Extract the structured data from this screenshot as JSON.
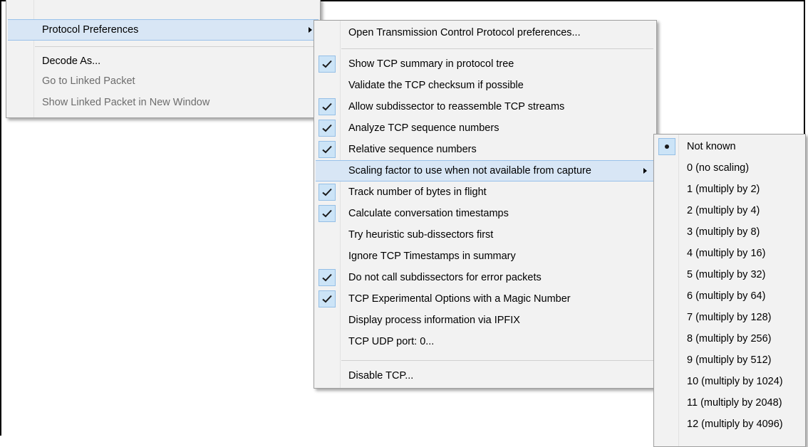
{
  "context_menu": {
    "items": [
      {
        "label": "Protocol Preferences",
        "enabled": true,
        "highlighted": true,
        "submenu": true
      },
      {
        "label": "Decode As...",
        "enabled": true
      },
      {
        "label": "Go to Linked Packet",
        "enabled": false
      },
      {
        "label": "Show Linked Packet in New Window",
        "enabled": false
      }
    ]
  },
  "protocol_menu": {
    "open_prefs": "Open Transmission Control Protocol preferences...",
    "items": [
      {
        "label": "Show TCP summary in protocol tree",
        "checked": true
      },
      {
        "label": "Validate the TCP checksum if possible",
        "checked": false
      },
      {
        "label": "Allow subdissector to reassemble TCP streams",
        "checked": true
      },
      {
        "label": "Analyze TCP sequence numbers",
        "checked": true
      },
      {
        "label": "Relative sequence numbers",
        "checked": true
      },
      {
        "label": "Scaling factor to use when not available from capture",
        "checked": false,
        "submenu": true,
        "highlighted": true
      },
      {
        "label": "Track number of bytes in flight",
        "checked": true
      },
      {
        "label": "Calculate conversation timestamps",
        "checked": true
      },
      {
        "label": "Try heuristic sub-dissectors first",
        "checked": false
      },
      {
        "label": "Ignore TCP Timestamps in summary",
        "checked": false
      },
      {
        "label": "Do not call subdissectors for error packets",
        "checked": true
      },
      {
        "label": "TCP Experimental Options with a Magic Number",
        "checked": true
      },
      {
        "label": "Display process information via IPFIX",
        "checked": false
      },
      {
        "label": "TCP UDP port: 0...",
        "checked": false
      }
    ],
    "disable": "Disable TCP..."
  },
  "scaling_menu": {
    "items": [
      {
        "label": "Not known",
        "selected": true
      },
      {
        "label": "0 (no scaling)"
      },
      {
        "label": "1 (multiply by 2)"
      },
      {
        "label": "2 (multiply by 4)"
      },
      {
        "label": "3 (multiply by 8)"
      },
      {
        "label": "4 (multiply by 16)"
      },
      {
        "label": "5 (multiply by 32)"
      },
      {
        "label": "6 (multiply by 64)"
      },
      {
        "label": "7 (multiply by 128)"
      },
      {
        "label": "8 (multiply by 256)"
      },
      {
        "label": "9 (multiply by 512)"
      },
      {
        "label": "10 (multiply by 1024)"
      },
      {
        "label": "11 (multiply by 2048)"
      },
      {
        "label": "12 (multiply by 4096)"
      }
    ]
  },
  "colors": {
    "menu_bg": "#f2f2f2",
    "highlight": "#d8e6f5",
    "check_bg": "#cce4f7",
    "check_mark": "#1a1a1a",
    "disabled_text": "#6d6d6d"
  },
  "icons": [
    "checkmark-icon",
    "chevron-right-icon",
    "radio-bullet-icon"
  ]
}
